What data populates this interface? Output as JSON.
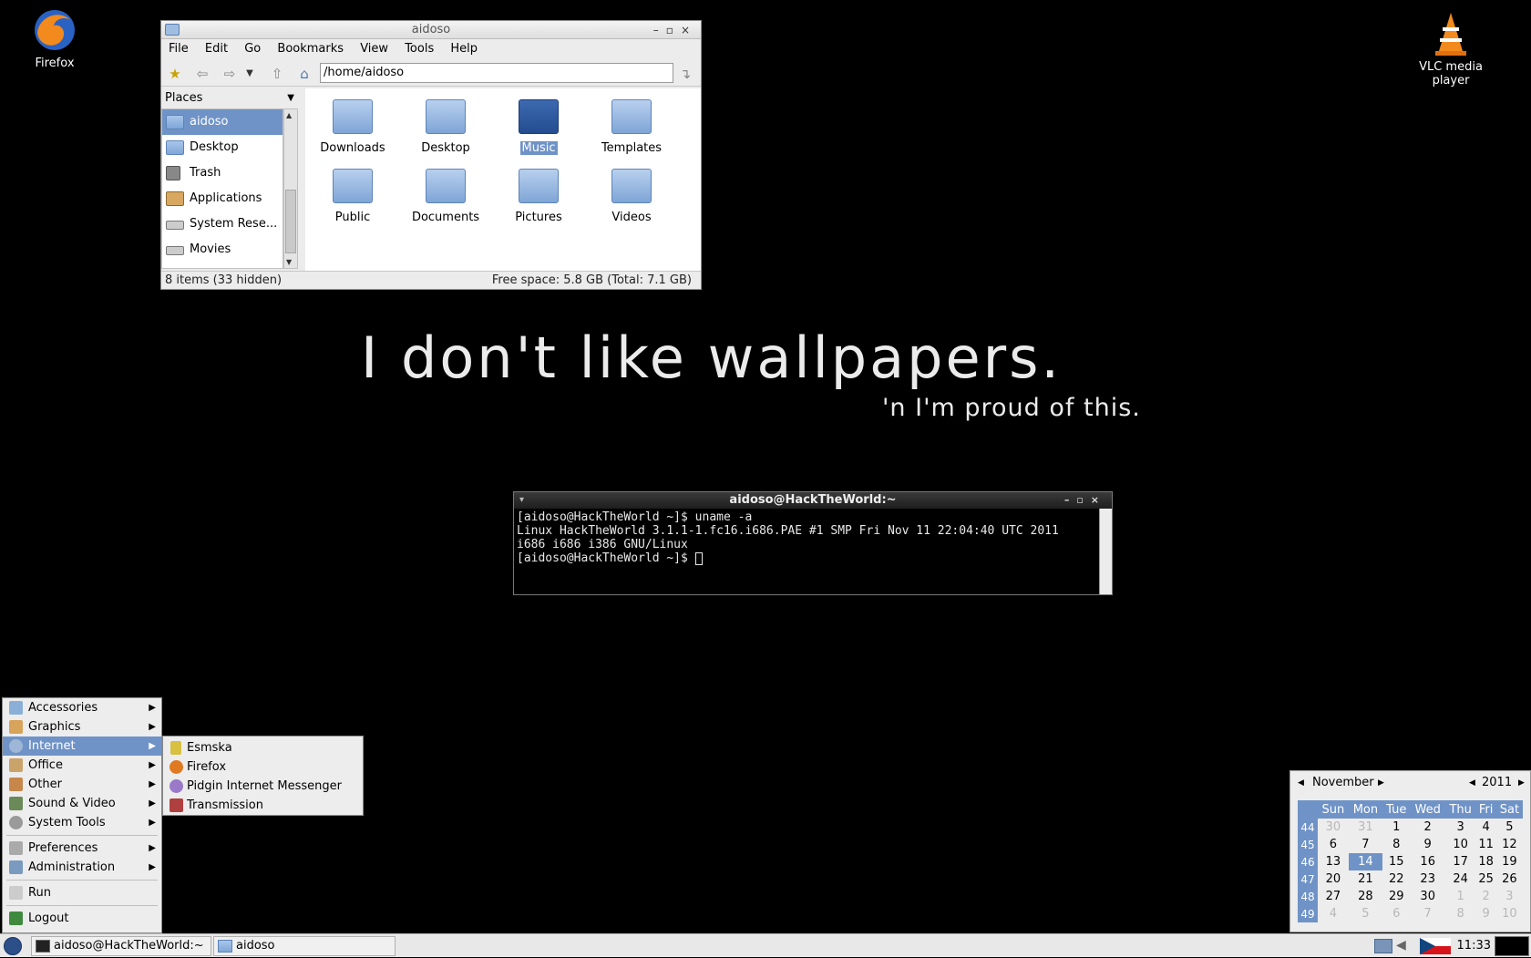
{
  "desktop": {
    "firefox_label": "Firefox",
    "vlc_label": "VLC media player",
    "slogan": "I don't like wallpapers.",
    "slogan_sub": "'n I'm proud of this."
  },
  "file_manager": {
    "title": "aidoso",
    "menu": [
      "File",
      "Edit",
      "Go",
      "Bookmarks",
      "View",
      "Tools",
      "Help"
    ],
    "location": "/home/aidoso",
    "places_label": "Places",
    "places": [
      "aidoso",
      "Desktop",
      "Trash",
      "Applications",
      "System Rese...",
      "Movies"
    ],
    "folders": [
      "Downloads",
      "Desktop",
      "Music",
      "Templates",
      "Public",
      "Documents",
      "Pictures",
      "Videos"
    ],
    "status_left": "8 items (33 hidden)",
    "status_right": "Free space: 5.8 GB (Total: 7.1 GB)"
  },
  "terminal": {
    "title": "aidoso@HackTheWorld:~",
    "lines": [
      "[aidoso@HackTheWorld ~]$ uname -a",
      "Linux HackTheWorld 3.1.1-1.fc16.i686.PAE #1 SMP Fri Nov 11 22:04:40 UTC 2011 i686 i686 i386 GNU/Linux",
      "[aidoso@HackTheWorld ~]$ "
    ]
  },
  "app_menu": {
    "items": [
      "Accessories",
      "Graphics",
      "Internet",
      "Office",
      "Other",
      "Sound & Video",
      "System Tools"
    ],
    "items2": [
      "Preferences",
      "Administration"
    ],
    "run": "Run",
    "logout": "Logout"
  },
  "internet_submenu": [
    "Esmska",
    "Firefox",
    "Pidgin Internet Messenger",
    "Transmission"
  ],
  "calendar": {
    "month": "November",
    "year": "2011",
    "weekdays": [
      "Sun",
      "Mon",
      "Tue",
      "Wed",
      "Thu",
      "Fri",
      "Sat"
    ],
    "weeks": [
      {
        "wk": "44",
        "days": [
          "30",
          "31",
          "1",
          "2",
          "3",
          "4",
          "5"
        ]
      },
      {
        "wk": "45",
        "days": [
          "6",
          "7",
          "8",
          "9",
          "10",
          "11",
          "12"
        ]
      },
      {
        "wk": "46",
        "days": [
          "13",
          "14",
          "15",
          "16",
          "17",
          "18",
          "19"
        ]
      },
      {
        "wk": "47",
        "days": [
          "20",
          "21",
          "22",
          "23",
          "24",
          "25",
          "26"
        ]
      },
      {
        "wk": "48",
        "days": [
          "27",
          "28",
          "29",
          "30",
          "1",
          "2",
          "3"
        ]
      },
      {
        "wk": "49",
        "days": [
          "4",
          "5",
          "6",
          "7",
          "8",
          "9",
          "10"
        ]
      }
    ],
    "today": "14"
  },
  "taskbar": {
    "tasks": [
      "aidoso@HackTheWorld:~",
      "aidoso"
    ],
    "clock": "11:33"
  }
}
